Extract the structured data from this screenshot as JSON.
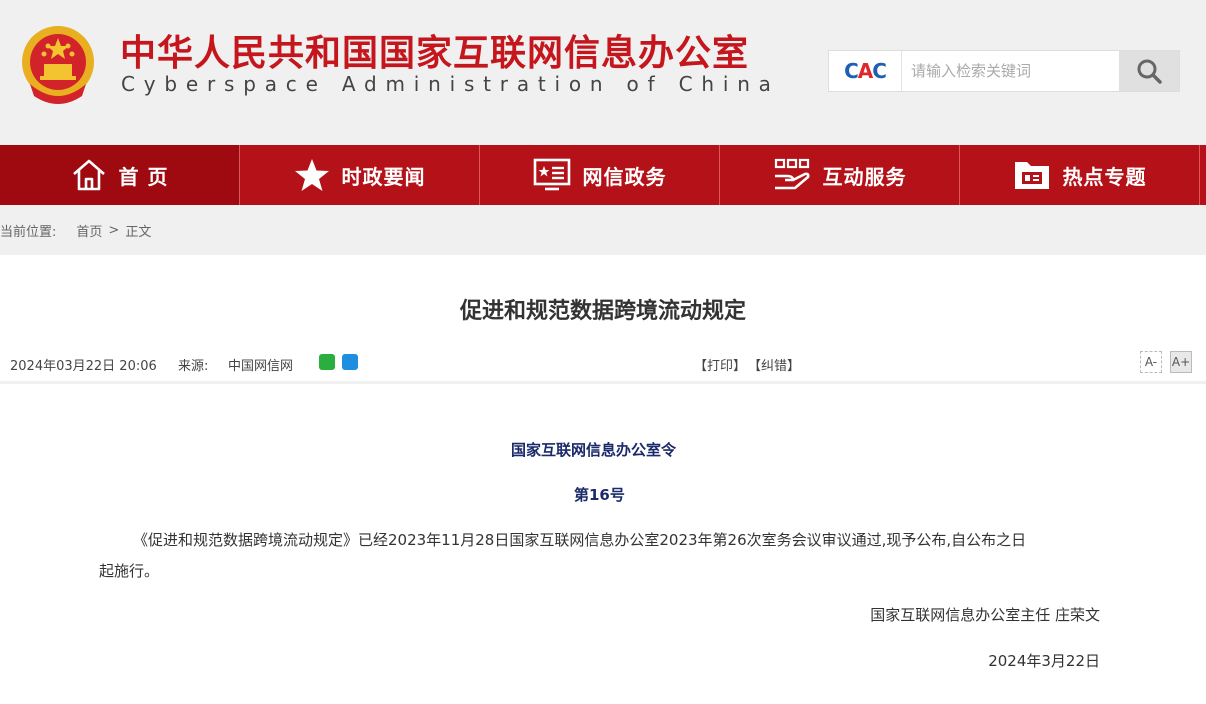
{
  "header": {
    "title_cn": "中华人民共和国国家互联网信息办公室",
    "title_en": "Cyberspace Administration of China",
    "logo_text": "CAC",
    "search_placeholder": "请输入检索关键词"
  },
  "colors": {
    "brand_red": "#b41218",
    "title_red": "#c4161c",
    "navy": "#1a2a6a"
  },
  "nav": [
    {
      "label": "首 页",
      "icon": "home-icon"
    },
    {
      "label": "时政要闻",
      "icon": "star-icon"
    },
    {
      "label": "网信政务",
      "icon": "screen-star-icon"
    },
    {
      "label": "互动服务",
      "icon": "hand-icon"
    },
    {
      "label": "热点专题",
      "icon": "folder-icon"
    }
  ],
  "breadcrumb": {
    "prefix": "当前位置:",
    "home": "首页",
    "sep": ">",
    "current": "正文"
  },
  "article": {
    "title": "促进和规范数据跨境流动规定",
    "date": "2024年03月22日 20:06",
    "source_label": "来源:",
    "source": "中国网信网",
    "print": "【打印】",
    "correct": "【纠错】",
    "font_minus": "A-",
    "font_plus": "A+",
    "order_title": "国家互联网信息办公室令",
    "order_no": "第16号",
    "body_line1": "《促进和规范数据跨境流动规定》已经2023年11月28日国家互联网信息办公室2023年第26次室务会议审议通过,现予公布,自公布之日",
    "body_line2": "起施行。",
    "signature": "国家互联网信息办公室主任 庄荣文",
    "sign_date": "2024年3月22日"
  }
}
